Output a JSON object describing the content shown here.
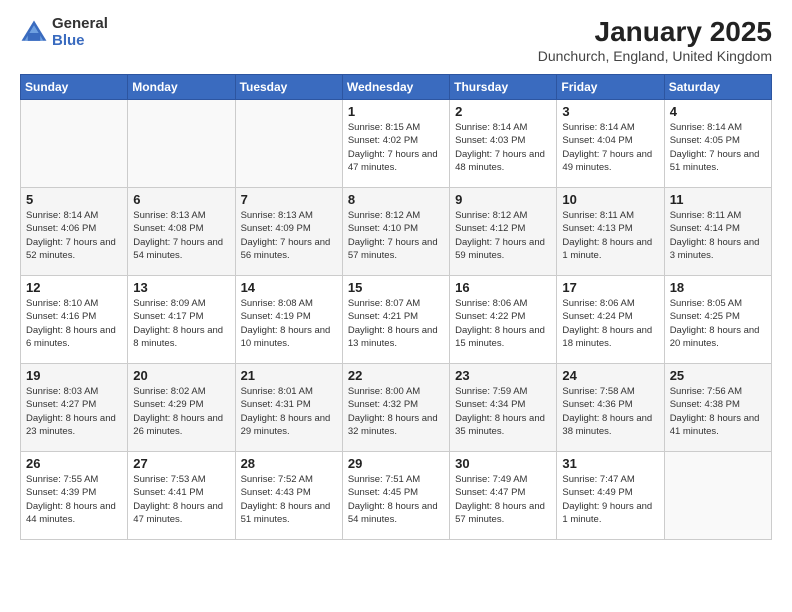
{
  "logo": {
    "general": "General",
    "blue": "Blue"
  },
  "header": {
    "title": "January 2025",
    "location": "Dunchurch, England, United Kingdom"
  },
  "weekdays": [
    "Sunday",
    "Monday",
    "Tuesday",
    "Wednesday",
    "Thursday",
    "Friday",
    "Saturday"
  ],
  "weeks": [
    [
      {
        "day": "",
        "info": ""
      },
      {
        "day": "",
        "info": ""
      },
      {
        "day": "",
        "info": ""
      },
      {
        "day": "1",
        "info": "Sunrise: 8:15 AM\nSunset: 4:02 PM\nDaylight: 7 hours and 47 minutes."
      },
      {
        "day": "2",
        "info": "Sunrise: 8:14 AM\nSunset: 4:03 PM\nDaylight: 7 hours and 48 minutes."
      },
      {
        "day": "3",
        "info": "Sunrise: 8:14 AM\nSunset: 4:04 PM\nDaylight: 7 hours and 49 minutes."
      },
      {
        "day": "4",
        "info": "Sunrise: 8:14 AM\nSunset: 4:05 PM\nDaylight: 7 hours and 51 minutes."
      }
    ],
    [
      {
        "day": "5",
        "info": "Sunrise: 8:14 AM\nSunset: 4:06 PM\nDaylight: 7 hours and 52 minutes."
      },
      {
        "day": "6",
        "info": "Sunrise: 8:13 AM\nSunset: 4:08 PM\nDaylight: 7 hours and 54 minutes."
      },
      {
        "day": "7",
        "info": "Sunrise: 8:13 AM\nSunset: 4:09 PM\nDaylight: 7 hours and 56 minutes."
      },
      {
        "day": "8",
        "info": "Sunrise: 8:12 AM\nSunset: 4:10 PM\nDaylight: 7 hours and 57 minutes."
      },
      {
        "day": "9",
        "info": "Sunrise: 8:12 AM\nSunset: 4:12 PM\nDaylight: 7 hours and 59 minutes."
      },
      {
        "day": "10",
        "info": "Sunrise: 8:11 AM\nSunset: 4:13 PM\nDaylight: 8 hours and 1 minute."
      },
      {
        "day": "11",
        "info": "Sunrise: 8:11 AM\nSunset: 4:14 PM\nDaylight: 8 hours and 3 minutes."
      }
    ],
    [
      {
        "day": "12",
        "info": "Sunrise: 8:10 AM\nSunset: 4:16 PM\nDaylight: 8 hours and 6 minutes."
      },
      {
        "day": "13",
        "info": "Sunrise: 8:09 AM\nSunset: 4:17 PM\nDaylight: 8 hours and 8 minutes."
      },
      {
        "day": "14",
        "info": "Sunrise: 8:08 AM\nSunset: 4:19 PM\nDaylight: 8 hours and 10 minutes."
      },
      {
        "day": "15",
        "info": "Sunrise: 8:07 AM\nSunset: 4:21 PM\nDaylight: 8 hours and 13 minutes."
      },
      {
        "day": "16",
        "info": "Sunrise: 8:06 AM\nSunset: 4:22 PM\nDaylight: 8 hours and 15 minutes."
      },
      {
        "day": "17",
        "info": "Sunrise: 8:06 AM\nSunset: 4:24 PM\nDaylight: 8 hours and 18 minutes."
      },
      {
        "day": "18",
        "info": "Sunrise: 8:05 AM\nSunset: 4:25 PM\nDaylight: 8 hours and 20 minutes."
      }
    ],
    [
      {
        "day": "19",
        "info": "Sunrise: 8:03 AM\nSunset: 4:27 PM\nDaylight: 8 hours and 23 minutes."
      },
      {
        "day": "20",
        "info": "Sunrise: 8:02 AM\nSunset: 4:29 PM\nDaylight: 8 hours and 26 minutes."
      },
      {
        "day": "21",
        "info": "Sunrise: 8:01 AM\nSunset: 4:31 PM\nDaylight: 8 hours and 29 minutes."
      },
      {
        "day": "22",
        "info": "Sunrise: 8:00 AM\nSunset: 4:32 PM\nDaylight: 8 hours and 32 minutes."
      },
      {
        "day": "23",
        "info": "Sunrise: 7:59 AM\nSunset: 4:34 PM\nDaylight: 8 hours and 35 minutes."
      },
      {
        "day": "24",
        "info": "Sunrise: 7:58 AM\nSunset: 4:36 PM\nDaylight: 8 hours and 38 minutes."
      },
      {
        "day": "25",
        "info": "Sunrise: 7:56 AM\nSunset: 4:38 PM\nDaylight: 8 hours and 41 minutes."
      }
    ],
    [
      {
        "day": "26",
        "info": "Sunrise: 7:55 AM\nSunset: 4:39 PM\nDaylight: 8 hours and 44 minutes."
      },
      {
        "day": "27",
        "info": "Sunrise: 7:53 AM\nSunset: 4:41 PM\nDaylight: 8 hours and 47 minutes."
      },
      {
        "day": "28",
        "info": "Sunrise: 7:52 AM\nSunset: 4:43 PM\nDaylight: 8 hours and 51 minutes."
      },
      {
        "day": "29",
        "info": "Sunrise: 7:51 AM\nSunset: 4:45 PM\nDaylight: 8 hours and 54 minutes."
      },
      {
        "day": "30",
        "info": "Sunrise: 7:49 AM\nSunset: 4:47 PM\nDaylight: 8 hours and 57 minutes."
      },
      {
        "day": "31",
        "info": "Sunrise: 7:47 AM\nSunset: 4:49 PM\nDaylight: 9 hours and 1 minute."
      },
      {
        "day": "",
        "info": ""
      }
    ]
  ]
}
